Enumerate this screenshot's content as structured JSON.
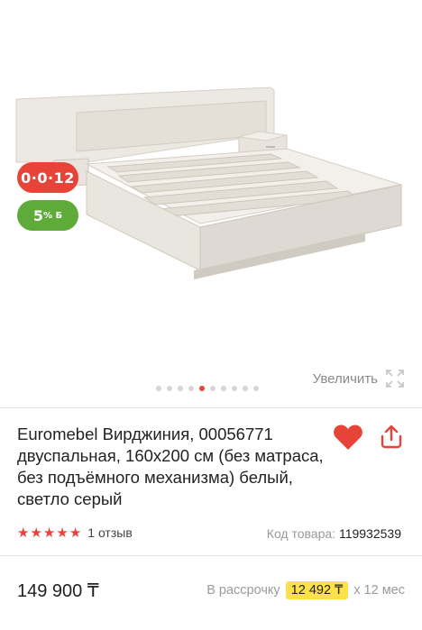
{
  "product": {
    "title": "Euromebel Вирджиния, 00056771 двуспальная, 160x200 см (без матраса, без подъёмного механизма) белый, светло серый",
    "badges": {
      "installment": "0·0·12",
      "bonus_value": "5",
      "bonus_suffix": "% Б"
    },
    "gallery": {
      "zoom_label": "Увеличить",
      "dot_count": 10,
      "active_index": 4
    },
    "rating": {
      "stars": 5,
      "star_glyph": "★",
      "reviews_text": "1 отзыв"
    },
    "code": {
      "label": "Код товара:",
      "value": "119932539"
    },
    "price": "149 900 ₸",
    "installment": {
      "label": "В рассрочку",
      "amount": "12 492 ₸",
      "term": "x 12 мес"
    }
  },
  "colors": {
    "accent": "#e84339",
    "bonus": "#5eab3a",
    "highlight": "#fde14a"
  },
  "icons": {
    "favorite": "heart-icon",
    "share": "share-icon",
    "zoom": "expand-icon",
    "star": "star-icon"
  }
}
